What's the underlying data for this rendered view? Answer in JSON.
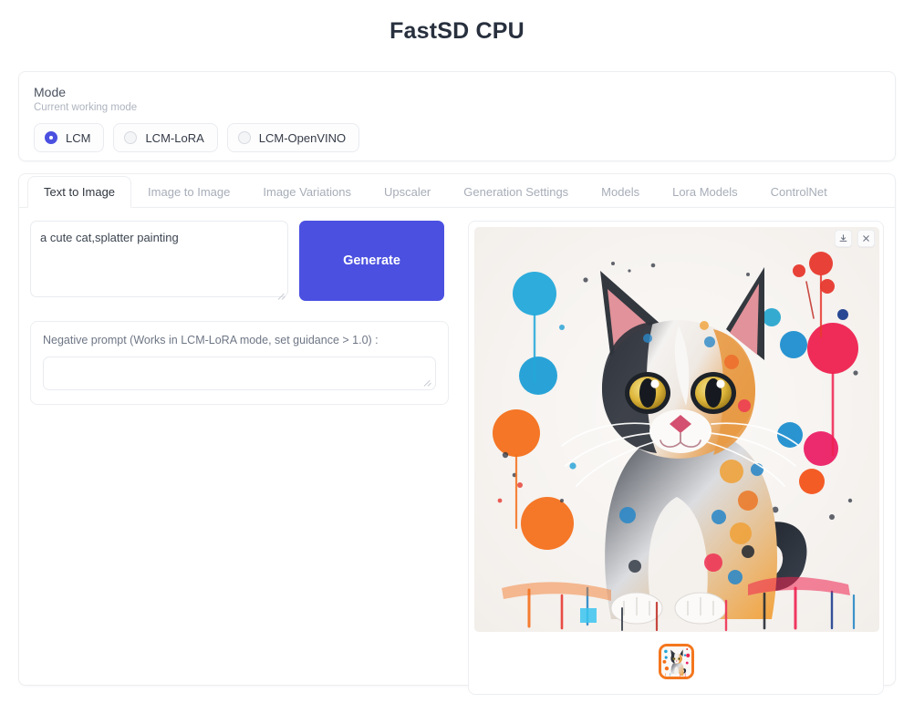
{
  "app": {
    "title": "FastSD CPU"
  },
  "mode": {
    "label": "Mode",
    "description": "Current working mode",
    "selected": "LCM",
    "options": [
      {
        "label": "LCM",
        "selected": true
      },
      {
        "label": "LCM-LoRA",
        "selected": false
      },
      {
        "label": "LCM-OpenVINO",
        "selected": false
      }
    ]
  },
  "tabs": [
    {
      "label": "Text to Image",
      "active": true
    },
    {
      "label": "Image to Image",
      "active": false
    },
    {
      "label": "Image Variations",
      "active": false
    },
    {
      "label": "Upscaler",
      "active": false
    },
    {
      "label": "Generation Settings",
      "active": false
    },
    {
      "label": "Models",
      "active": false
    },
    {
      "label": "Lora Models",
      "active": false
    },
    {
      "label": "ControlNet",
      "active": false
    }
  ],
  "text_to_image": {
    "prompt": {
      "value": "a cute cat,splatter painting",
      "placeholder": ""
    },
    "generate_button": "Generate",
    "negative_prompt": {
      "label": "Negative prompt (Works in LCM-LoRA mode, set guidance > 1.0) :",
      "value": "",
      "placeholder": ""
    }
  },
  "result": {
    "image_description": "Splatter painting of a cute calico kitten with colorful paint splashes on a white background",
    "download_icon": "download-icon",
    "close_icon": "close-icon",
    "thumbnails": [
      {
        "selected": true,
        "description": "splatter painting cat thumbnail"
      }
    ]
  },
  "colors": {
    "accent": "#4b50e0",
    "title": "#28303e",
    "thumbnail_selected_border": "#f4761d",
    "panel_border": "#eceef1",
    "muted_text": "#a7adb8"
  }
}
